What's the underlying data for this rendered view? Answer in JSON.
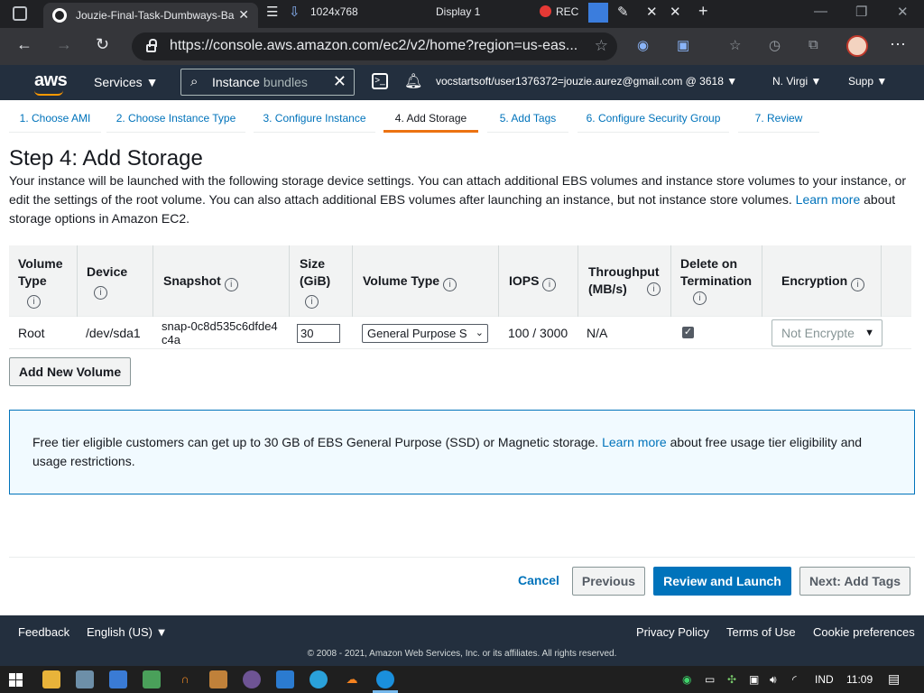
{
  "browser": {
    "tab_title": "Jouzie-Final-Task-Dumbways-Ba",
    "toolbar_resolution": "1024x768",
    "toolbar_display": "Display 1",
    "toolbar_rec": "REC",
    "url": "https://console.aws.amazon.com/ec2/v2/home?region=us-eas..."
  },
  "aws_nav": {
    "logo": "aws",
    "services": "Services ▼",
    "search_bold": "Instance",
    "search_rest": " bundles",
    "account": "vocstartsoft/user1376372=jouzie.aurez@gmail.com @ 3618 ▼",
    "region": "N. Virgi ▼",
    "support": "Supp ▼"
  },
  "steps": [
    "1. Choose AMI",
    "2. Choose Instance Type",
    "3. Configure Instance",
    "4. Add Storage",
    "5. Add Tags",
    "6. Configure Security Group",
    "7. Review"
  ],
  "active_step": "4. Add Storage",
  "page": {
    "title": "Step 4: Add Storage",
    "description": "Your instance will be launched with the following storage device settings. You can attach additional EBS volumes and instance store volumes to your instance, or edit the settings of the root volume. You can also attach additional EBS volumes after launching an instance, but not instance store volumes.",
    "learn_more": "Learn more",
    "description_tail": "about storage options in Amazon EC2."
  },
  "table": {
    "headers": {
      "volume_type": "Volume Type",
      "device": "Device",
      "snapshot": "Snapshot",
      "size": "Size (GiB)",
      "volume_type2": "Volume Type",
      "iops": "IOPS",
      "throughput": "Throughput (MB/s)",
      "delete_on_termination": "Delete on Termination",
      "encryption": "Encryption"
    },
    "row": {
      "volume_type": "Root",
      "device": "/dev/sda1",
      "snapshot": "snap-0c8d535c6dfde4c4a",
      "size": "30",
      "volume_type2": "General Purpose S",
      "iops": "100 / 3000",
      "throughput": "N/A",
      "delete_on_termination": true,
      "encryption": "Not Encrypte"
    }
  },
  "buttons": {
    "add_volume": "Add New Volume",
    "cancel": "Cancel",
    "previous": "Previous",
    "review_launch": "Review and Launch",
    "next": "Next: Add Tags"
  },
  "info_box": {
    "text": "Free tier eligible customers can get up to 30 GB of EBS General Purpose (SSD) or Magnetic storage.",
    "learn_more": "Learn more",
    "tail": "about free usage tier eligibility and usage restrictions."
  },
  "footer": {
    "feedback": "Feedback",
    "language": "English (US) ▼",
    "privacy": "Privacy Policy",
    "terms": "Terms of Use",
    "cookies": "Cookie preferences",
    "copyright": "© 2008 - 2021, Amazon Web Services, Inc. or its affiliates. All rights reserved."
  },
  "taskbar": {
    "language": "IND",
    "time": "11:09"
  },
  "colors": {
    "aws_nav_bg": "#232f3e",
    "link_blue": "#0073bb",
    "active_orange": "#ec7211",
    "info_bg": "#f1faff"
  }
}
